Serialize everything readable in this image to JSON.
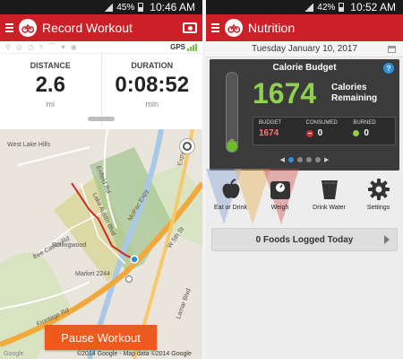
{
  "left": {
    "status": {
      "battery": "45%",
      "time": "10:46 AM"
    },
    "appbar": {
      "title": "Record Workout"
    },
    "gps_label": "GPS",
    "stats": [
      {
        "label": "DISTANCE",
        "value": "2.6",
        "unit": "mi"
      },
      {
        "label": "DURATION",
        "value": "0:08:52",
        "unit": "min"
      }
    ],
    "map": {
      "labels": {
        "west_lake_hills": "West Lake Hills",
        "enfield": "Enfield Rd",
        "lake_austin": "Lake Austin Blvd",
        "rollingwood": "Rollingwood",
        "bee_caves": "Bee Caves Rd",
        "frontage": "Frontage Rd",
        "w5th": "W 5th St",
        "lamar": "Lamar Blvd",
        "market": "Market 2244",
        "mopac": "MoPac Expy",
        "expressway": "Expy"
      },
      "copyright": "©2014 Google - Map data ©2014 Google",
      "google": "Google"
    },
    "pause_button": "Pause Workout"
  },
  "right": {
    "status": {
      "battery": "42%",
      "time": "10:52 AM"
    },
    "appbar": {
      "title": "Nutrition"
    },
    "date": "Tuesday January 10, 2017",
    "budget": {
      "title": "Calorie Budget",
      "remaining": "1674",
      "remaining_label_1": "Calories",
      "remaining_label_2": "Remaining",
      "fill_fraction": 0.1,
      "columns": [
        {
          "header": "BUDGET",
          "value": "1674"
        },
        {
          "header": "CONSUMED",
          "value": "0"
        },
        {
          "header": "BURNED",
          "value": "0"
        }
      ]
    },
    "actions": [
      {
        "label": "Eat or Drink",
        "icon": "apple-icon"
      },
      {
        "label": "Weigh",
        "icon": "scale-icon"
      },
      {
        "label": "Drink Water",
        "icon": "glass-icon"
      },
      {
        "label": "Settings",
        "icon": "gear-icon"
      }
    ],
    "foods_logged": "0 Foods Logged Today"
  },
  "colors": {
    "brand_red": "#cc1f27",
    "accent_green": "#8fd14f",
    "pause_orange": "#ee5a1d",
    "info_blue": "#2f8fd8"
  }
}
